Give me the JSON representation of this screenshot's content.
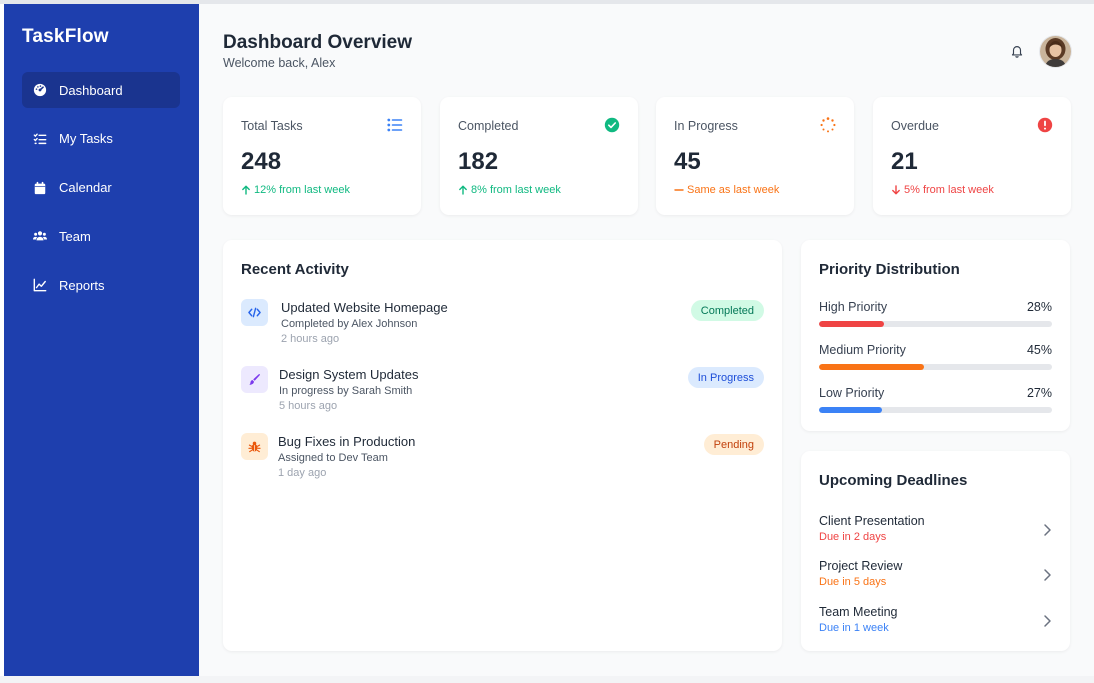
{
  "app": {
    "brand": "TaskFlow"
  },
  "sidebar": {
    "items": [
      {
        "label": "Dashboard",
        "icon": "gauge-icon",
        "active": true
      },
      {
        "label": "My Tasks",
        "icon": "tasks-icon",
        "active": false
      },
      {
        "label": "Calendar",
        "icon": "calendar-icon",
        "active": false
      },
      {
        "label": "Team",
        "icon": "team-icon",
        "active": false
      },
      {
        "label": "Reports",
        "icon": "chart-line-icon",
        "active": false
      }
    ]
  },
  "header": {
    "title": "Dashboard Overview",
    "subtitle": "Welcome back, Alex",
    "notification_icon": "bell-icon",
    "avatar_icon": "user-avatar"
  },
  "stats": [
    {
      "label": "Total Tasks",
      "value": "248",
      "change": "12% from last week",
      "trend": "up",
      "icon": "list-icon",
      "color": "#3b82f6"
    },
    {
      "label": "Completed",
      "value": "182",
      "change": "8% from last week",
      "trend": "up",
      "icon": "check-circle-icon",
      "color": "#10b981"
    },
    {
      "label": "In Progress",
      "value": "45",
      "change": "Same as last week",
      "trend": "flat",
      "icon": "spinner-icon",
      "color": "#f97316"
    },
    {
      "label": "Overdue",
      "value": "21",
      "change": "5% from last week",
      "trend": "down",
      "icon": "alert-circle-icon",
      "color": "#ef4444"
    }
  ],
  "activity": {
    "title": "Recent Activity",
    "items": [
      {
        "title": "Updated Website Homepage",
        "subtitle": "Completed by Alex Johnson",
        "time": "2 hours ago",
        "status": "Completed",
        "icon": "code-icon"
      },
      {
        "title": "Design System Updates",
        "subtitle": "In progress by Sarah Smith",
        "time": "5 hours ago",
        "status": "In Progress",
        "icon": "brush-icon"
      },
      {
        "title": "Bug Fixes in Production",
        "subtitle": "Assigned to Dev Team",
        "time": "1 day ago",
        "status": "Pending",
        "icon": "bug-icon"
      }
    ]
  },
  "priority": {
    "title": "Priority Distribution",
    "items": [
      {
        "label": "High Priority",
        "pct_text": "28%",
        "fraction": 0.28,
        "color": "#ef4444"
      },
      {
        "label": "Medium Priority",
        "pct_text": "45%",
        "fraction": 0.45,
        "color": "#f97316"
      },
      {
        "label": "Low Priority",
        "pct_text": "27%",
        "fraction": 0.27,
        "color": "#3b82f6"
      }
    ]
  },
  "deadlines": {
    "title": "Upcoming Deadlines",
    "items": [
      {
        "title": "Client Presentation",
        "due": "Due in 2 days",
        "color": "#ef4444"
      },
      {
        "title": "Project Review",
        "due": "Due in 5 days",
        "color": "#f97316"
      },
      {
        "title": "Team Meeting",
        "due": "Due in 1 week",
        "color": "#3b82f6"
      }
    ]
  },
  "colors": {
    "sidebar": "#1e3fae",
    "sidebar_active": "#1a348f",
    "green": "#10b981",
    "orange": "#f97316",
    "red": "#ef4444",
    "blue": "#3b82f6"
  }
}
